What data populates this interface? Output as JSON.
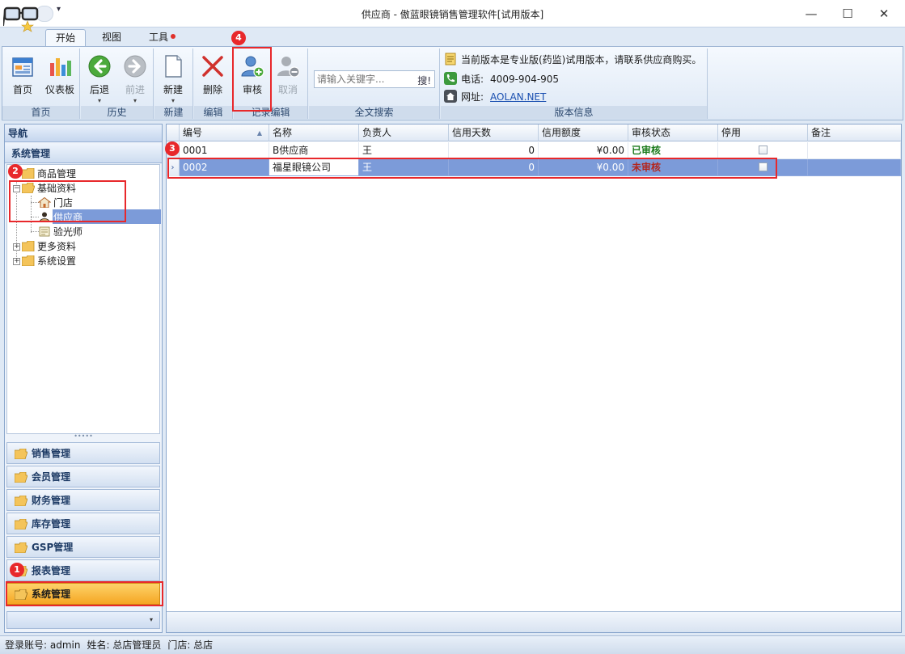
{
  "window": {
    "title": "供应商 - 傲蓝眼镜销售管理软件[试用版本]",
    "qat_arrow": "▾",
    "minimize": "—",
    "maximize": "☐",
    "close": "✕"
  },
  "tabs": [
    {
      "label": "开始",
      "active": true
    },
    {
      "label": "视图",
      "active": false
    },
    {
      "label": "工具",
      "active": false,
      "has_dot": true
    }
  ],
  "ribbon": {
    "groups": {
      "home": "首页",
      "history": "历史",
      "new": "新建",
      "edit": "编辑",
      "record_edit": "记录编辑",
      "fulltext": "全文搜索",
      "version": "版本信息"
    },
    "buttons": {
      "home": {
        "label": "首页",
        "icon": "home-icon"
      },
      "dashboard": {
        "label": "仪表板",
        "icon": "bar-chart-icon"
      },
      "back": {
        "label": "后退",
        "icon": "back-arrow-icon"
      },
      "forward": {
        "label": "前进",
        "icon": "forward-arrow-icon",
        "disabled": true
      },
      "new": {
        "label": "新建",
        "icon": "new-document-icon"
      },
      "delete": {
        "label": "删除",
        "icon": "delete-x-icon"
      },
      "approve": {
        "label": "审核",
        "icon": "user-add-icon"
      },
      "cancel": {
        "label": "取消",
        "icon": "user-remove-icon",
        "disabled": true
      }
    },
    "search": {
      "placeholder": "请输入关键字...",
      "button": "搜!"
    },
    "info": {
      "version_text": "当前版本是专业版(药监)试用版本，请联系供应商购买。",
      "phone_label": "电话:",
      "phone_value": "4009-904-905",
      "url_label": "网址:",
      "url_value": "AOLAN.NET"
    }
  },
  "nav": {
    "header": "导航",
    "section": "系统管理",
    "tree": {
      "goods": "商品管理",
      "basic": "基础资料",
      "store": "门店",
      "supplier": "供应商",
      "optometrist": "验光师",
      "more": "更多资料",
      "settings": "系统设置"
    },
    "splitter": "•••••",
    "modules": [
      "销售管理",
      "会员管理",
      "财务管理",
      "库存管理",
      "GSP管理",
      "报表管理",
      "系统管理"
    ],
    "active_module": "系统管理",
    "bottom_arrow": "▾"
  },
  "grid": {
    "columns": [
      "编号",
      "名称",
      "负责人",
      "信用天数",
      "信用额度",
      "审核状态",
      "停用",
      "备注"
    ],
    "sort_indicator": "▲",
    "row_indicator": "›",
    "rows": [
      {
        "code": "0001",
        "name": "B供应商",
        "owner": "王",
        "days": "0",
        "limit": "¥0.00",
        "status": "已审核",
        "disabled": false,
        "note": ""
      },
      {
        "code": "0002",
        "name": "福星眼镜公司",
        "owner": "王",
        "days": "0",
        "limit": "¥0.00",
        "status": "未审核",
        "disabled": false,
        "note": ""
      }
    ]
  },
  "status": {
    "account": "登录账号: admin",
    "name": "姓名: 总店管理员",
    "store": "门店: 总店"
  },
  "annotations": [
    "1",
    "2",
    "3",
    "4"
  ],
  "colors": {
    "accent": "#7c9bd9",
    "highlight": "#e8282b",
    "active_module": "#f5a623"
  }
}
